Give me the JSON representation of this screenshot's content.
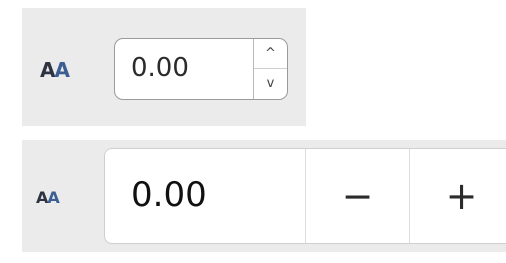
{
  "top_spinbox": {
    "icon": "font-size-icon",
    "icon_text_a": "A",
    "icon_text_b": "A",
    "value": "0.00",
    "up_glyph": "^",
    "down_glyph": "v"
  },
  "bottom_spinbox": {
    "icon": "font-size-icon",
    "icon_text_a": "A",
    "icon_text_b": "A",
    "value": "0.00",
    "minus_label": "−",
    "plus_label": "+"
  },
  "colors": {
    "panel_bg": "#ebebeb",
    "icon_dark": "#2d3340",
    "icon_blue": "#3b5f93"
  }
}
